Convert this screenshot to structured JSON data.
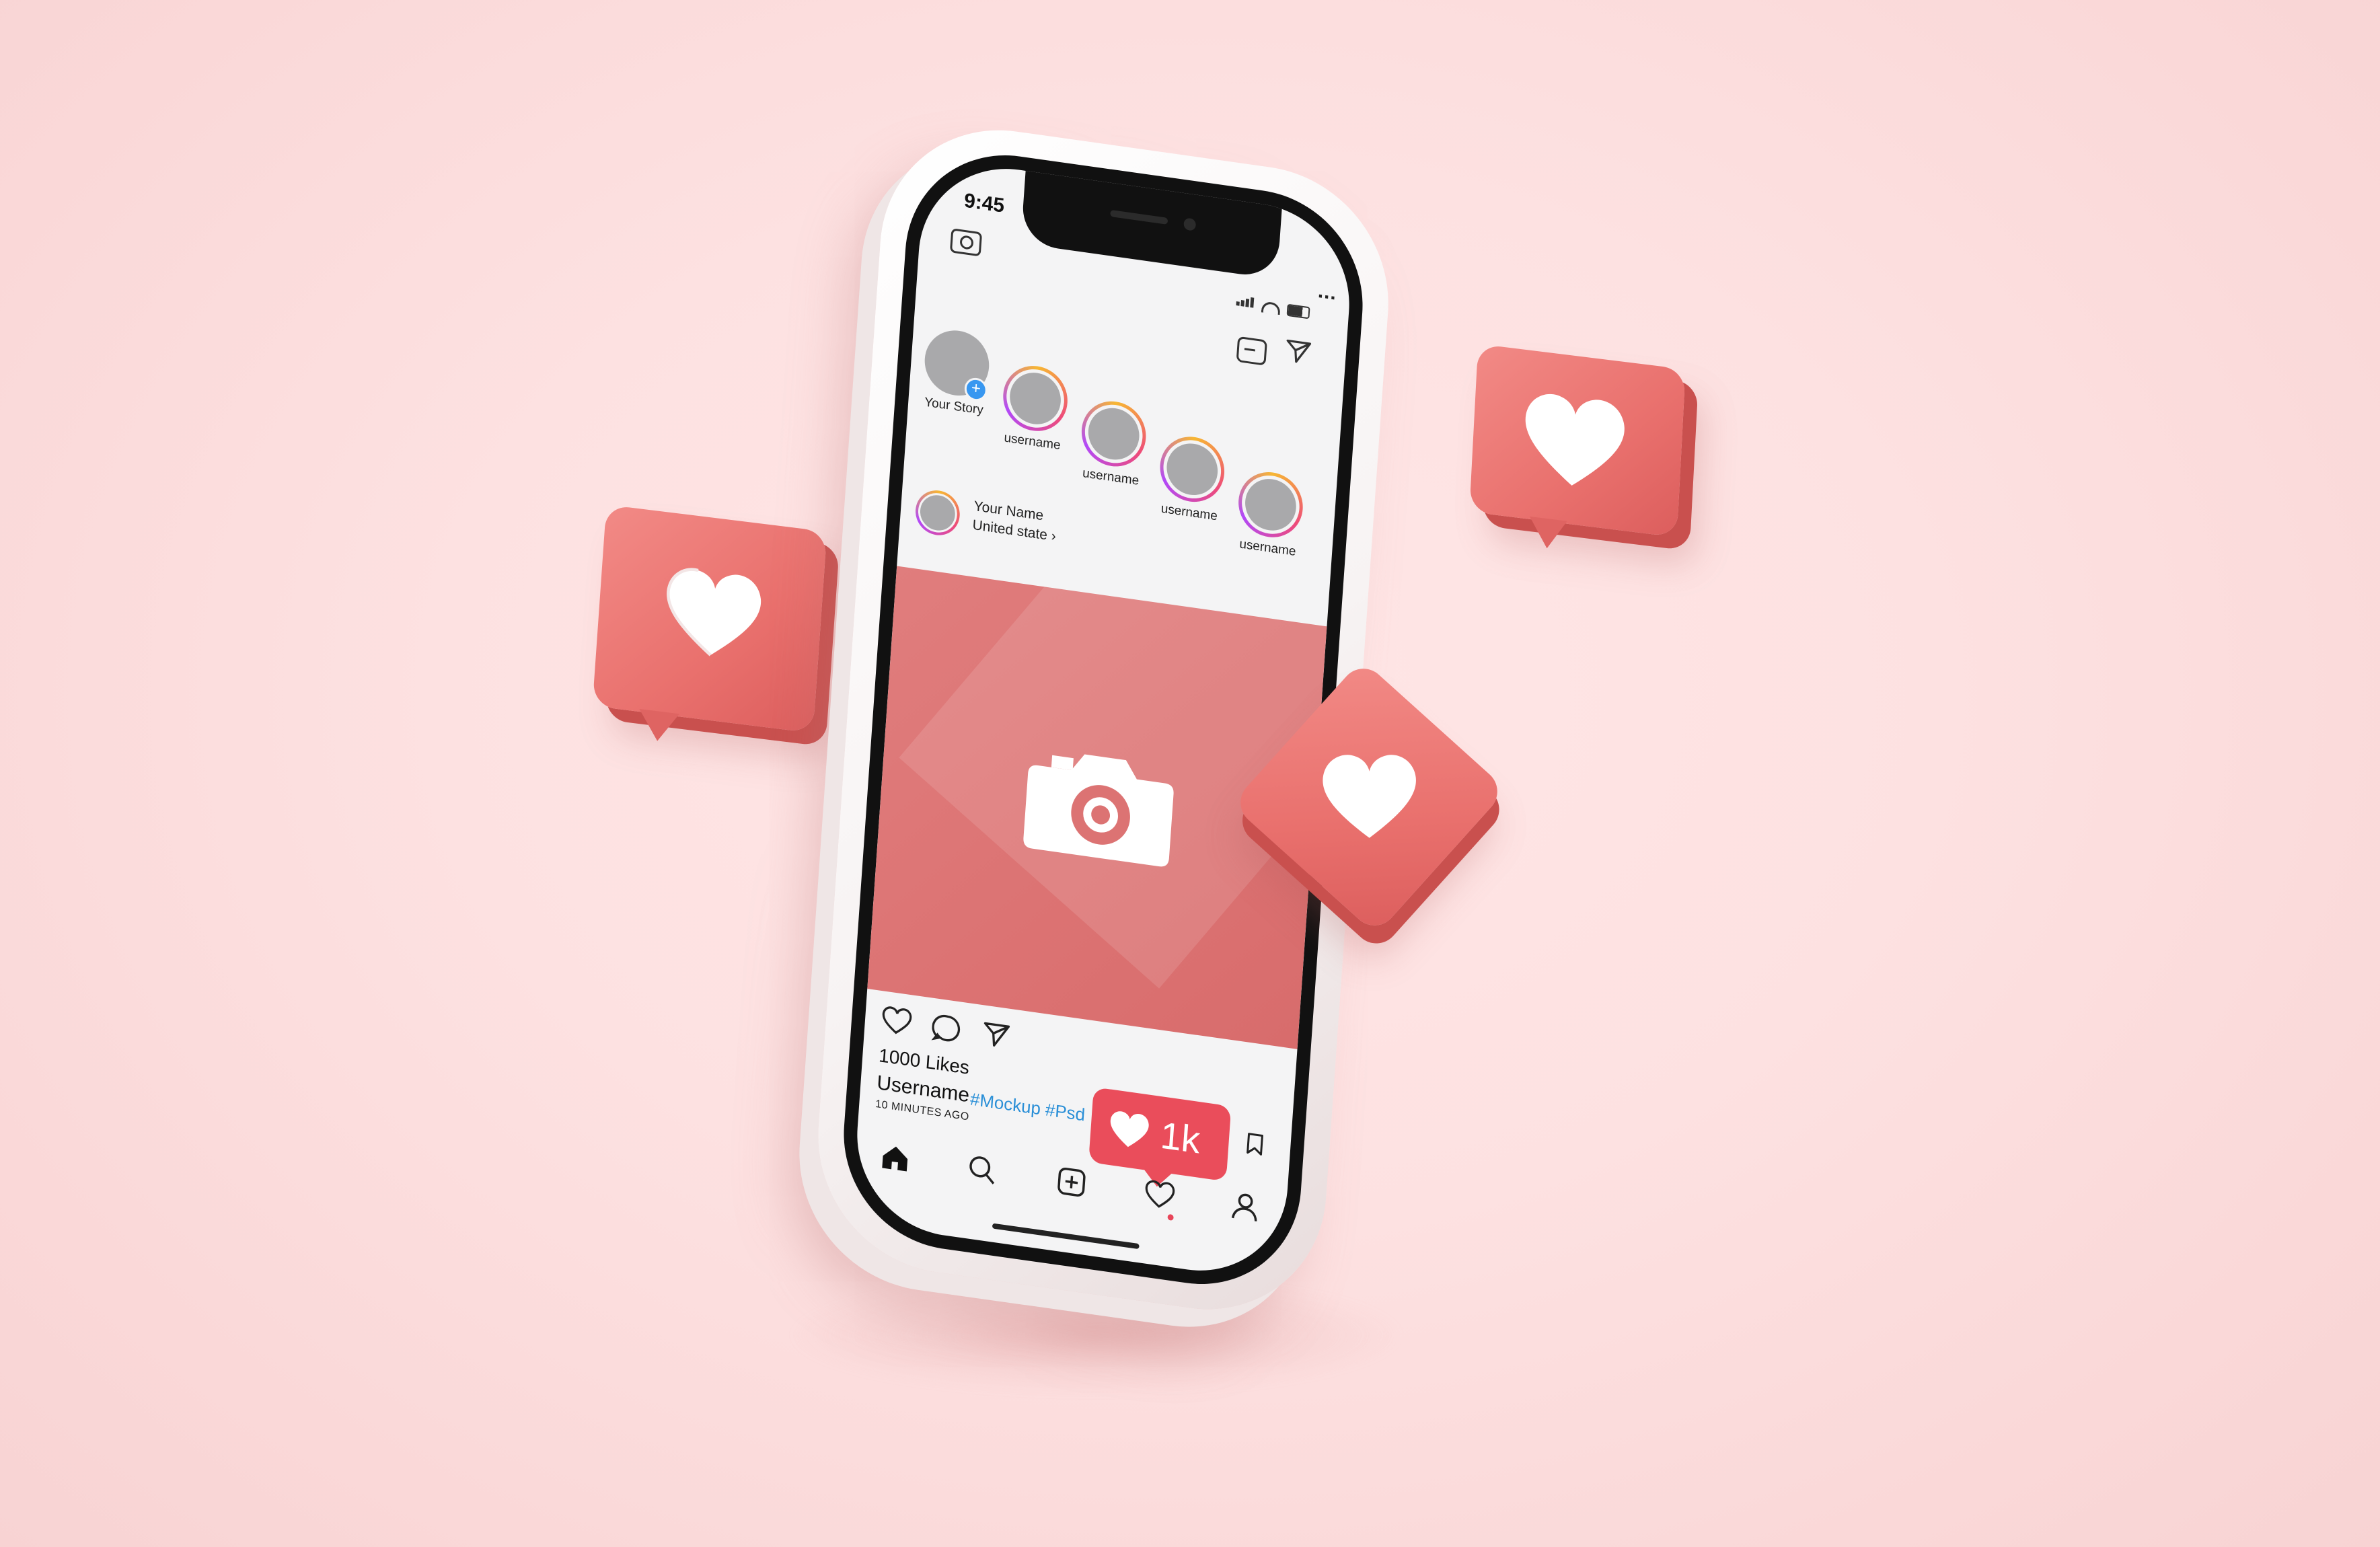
{
  "status_bar": {
    "time": "9:45"
  },
  "stories": [
    {
      "label": "Your Story",
      "own": true
    },
    {
      "label": "username"
    },
    {
      "label": "username"
    },
    {
      "label": "username"
    },
    {
      "label": "username"
    }
  ],
  "post": {
    "author_name": "Your Name",
    "location": "United state  ›",
    "more": "...",
    "likes": "1000 Likes",
    "username": "Username",
    "hashtags": "#Mockup #Psd",
    "time_ago": "10 MINUTES AGO"
  },
  "notification": {
    "like_count": "1k"
  },
  "icons": {
    "camera": "camera-icon",
    "igtv": "igtv-icon",
    "send": "send-icon",
    "like": "heart-icon",
    "comment": "comment-icon",
    "share": "share-icon",
    "bookmark": "bookmark-icon",
    "home": "home-icon",
    "search": "search-icon",
    "add": "add-icon",
    "activity": "heart-outline-icon",
    "profile": "profile-icon"
  },
  "colors": {
    "background": "#fde1e1",
    "accent_heart_card": "#e9706d",
    "post_image": "#dc7373",
    "like_badge": "#ea4d5b",
    "hashtag": "#2a8fd7",
    "story_plus": "#3897f0"
  }
}
